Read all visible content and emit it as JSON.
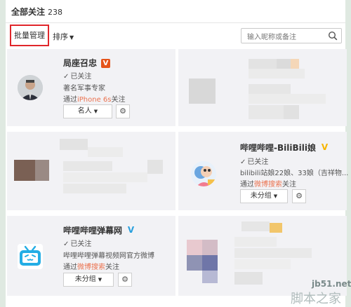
{
  "header": {
    "title": "全部关注",
    "count": "238"
  },
  "toolbar": {
    "batch_label": "批量管理",
    "sort_label": "排序",
    "search_placeholder": "输入昵称或备注"
  },
  "cards": {
    "c1": {
      "name": "局座召忠",
      "badge": "V",
      "status": "已关注",
      "intro": "著名军事专家",
      "via_prefix": "通过",
      "via_link": "iPhone 6s",
      "via_suffix": "关注",
      "group": "名人"
    },
    "c4": {
      "name": "哔哩哔哩-BiliBili娘",
      "badge": "V",
      "status": "已关注",
      "intro": "bilibili站娘22娘、33娘（吉祥物...",
      "via_prefix": "通过",
      "via_link": "微博搜索",
      "via_suffix": "关注",
      "group": "未分组"
    },
    "c5": {
      "name": "哔哩哔哩弹幕网",
      "badge": "V",
      "status": "已关注",
      "intro": "哔哩哔哩弹幕视频网官方微博",
      "via_prefix": "通过",
      "via_link": "微博搜索",
      "via_suffix": "关注",
      "group": "未分组"
    }
  },
  "watermark": {
    "site": "jb51.net",
    "brand": "脚本之家"
  },
  "colors": {
    "accent_orange": "#eb7350",
    "highlight_red": "#e0262b",
    "verified_gold": "#f7b500",
    "verified_blue": "#2aa0dd"
  }
}
